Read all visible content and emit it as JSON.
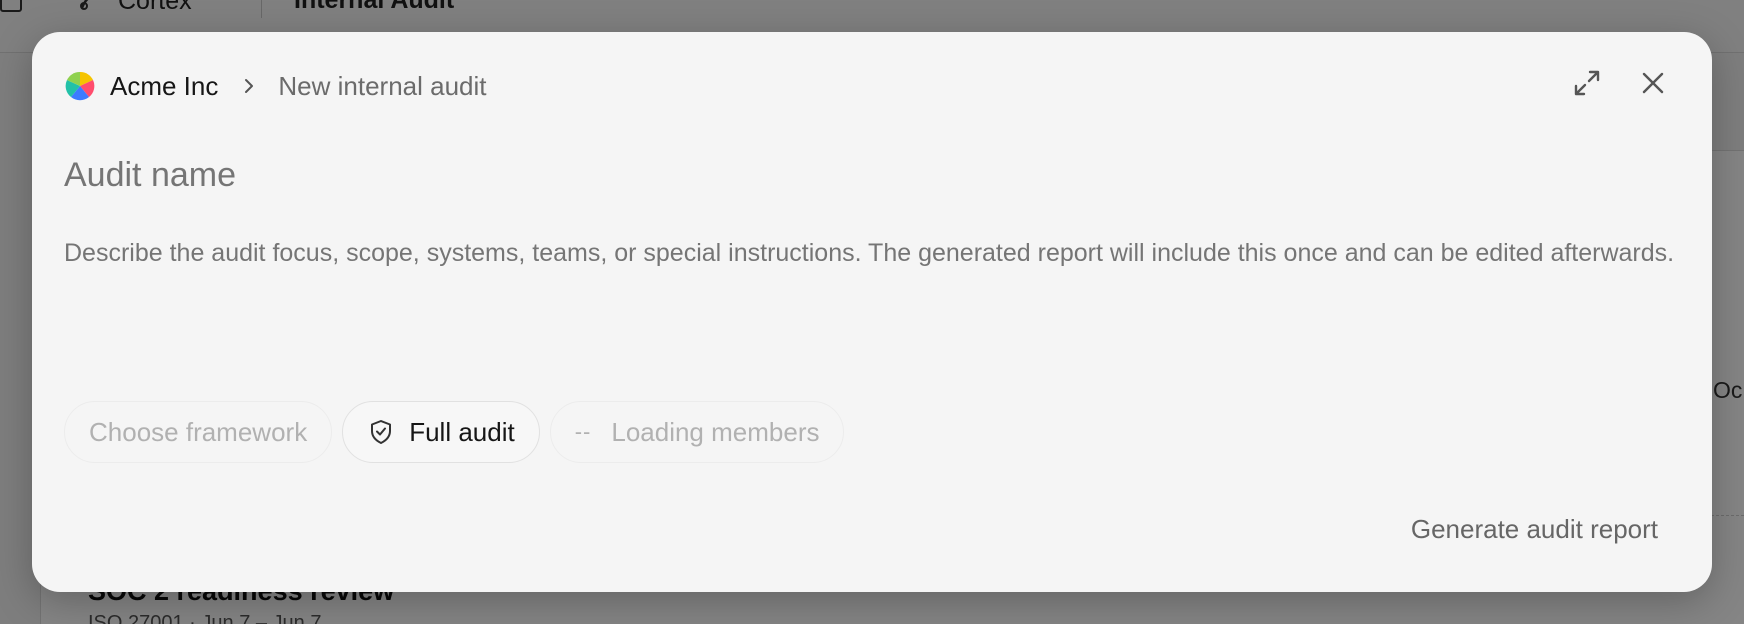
{
  "background": {
    "app_name": "Cortex",
    "page_title": "Internal Audit",
    "clipped_text": "Oc",
    "row_title": "SOC 2 readiness review",
    "row_meta": "ISO 27001 · Jun 7 – Jun 7"
  },
  "modal": {
    "breadcrumb": {
      "org_name": "Acme Inc",
      "current": "New internal audit"
    },
    "actions": {
      "expand_icon": "expand-icon",
      "close_icon": "close-icon"
    },
    "audit_name": {
      "value": "",
      "placeholder": "Audit name"
    },
    "description": {
      "value": "",
      "placeholder": "Describe the audit focus, scope, systems, teams, or special instructions. The generated report will include this once and can be edited afterwards."
    },
    "chips": {
      "framework": "Choose framework",
      "scope": "Full audit",
      "members_prefix": "--",
      "members": "Loading members"
    },
    "generate_label": "Generate audit report"
  },
  "colors": {
    "modal_bg": "#f5f5f5",
    "placeholder": "#a9a9a9",
    "text_primary": "#161616",
    "logo_colors": [
      "#f5c400",
      "#ff4d6d",
      "#3d7bff",
      "#22c1a8"
    ]
  }
}
